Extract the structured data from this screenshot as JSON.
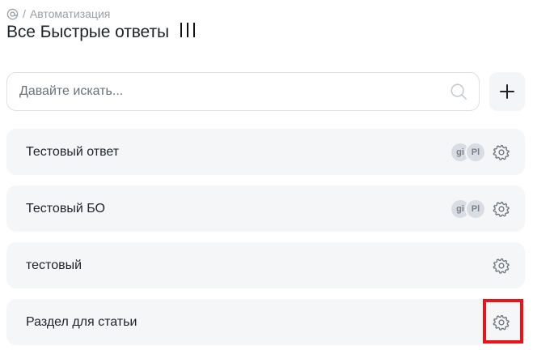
{
  "breadcrumb": {
    "home_icon": "at-icon",
    "separator": "/",
    "current": "Автоматизация"
  },
  "page": {
    "title": "Все Быстрые ответы",
    "menu_icon": "triple-bar-icon"
  },
  "search": {
    "placeholder": "Давайте искать...",
    "value": "",
    "icon": "search-icon"
  },
  "add_button": {
    "label": "+",
    "icon": "plus-icon"
  },
  "items": [
    {
      "label": "Тестовый ответ",
      "avatars": [
        "gi",
        "Pl"
      ],
      "settings_icon": "gear-icon"
    },
    {
      "label": "Тестовый БО",
      "avatars": [
        "gi",
        "Pl"
      ],
      "settings_icon": "gear-icon"
    },
    {
      "label": "тестовый",
      "avatars": [],
      "settings_icon": "gear-icon"
    },
    {
      "label": "Раздел для статьи",
      "avatars": [],
      "settings_icon": "gear-icon"
    }
  ],
  "colors": {
    "highlight": "#e8141c",
    "row_background": "#f5f6f8",
    "avatar_background": "#d9dde3"
  }
}
